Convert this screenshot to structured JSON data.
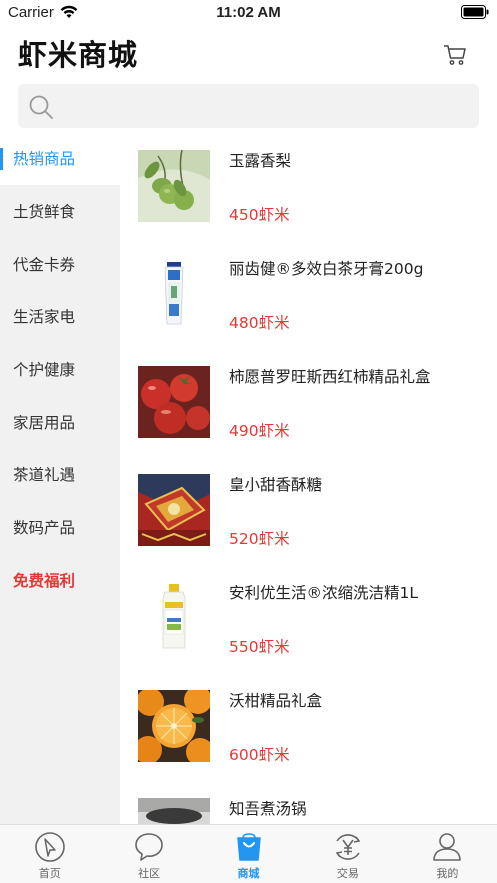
{
  "status_bar": {
    "carrier": "Carrier",
    "time": "11:02 AM"
  },
  "header": {
    "title": "虾米商城",
    "cart_icon": "cart-icon"
  },
  "search": {
    "placeholder": "",
    "value": "",
    "icon": "search-icon"
  },
  "sidebar": {
    "items": [
      {
        "label": "热销商品",
        "state": "active"
      },
      {
        "label": "土货鲜食",
        "state": "normal"
      },
      {
        "label": "代金卡券",
        "state": "normal"
      },
      {
        "label": "生活家电",
        "state": "normal"
      },
      {
        "label": "个护健康",
        "state": "normal"
      },
      {
        "label": "家居用品",
        "state": "normal"
      },
      {
        "label": "茶道礼遇",
        "state": "normal"
      },
      {
        "label": "数码产品",
        "state": "normal"
      },
      {
        "label": "免费福利",
        "state": "highlight"
      }
    ]
  },
  "products": [
    {
      "name": "玉露香梨",
      "price": "450虾米"
    },
    {
      "name": "丽齿健®多效白茶牙膏200g",
      "price": "480虾米"
    },
    {
      "name": "柿愿普罗旺斯西红柿精品礼盒",
      "price": "490虾米"
    },
    {
      "name": "皇小甜香酥糖",
      "price": "520虾米"
    },
    {
      "name": "安利优生活®浓缩洗洁精1L",
      "price": "550虾米"
    },
    {
      "name": "沃柑精品礼盒",
      "price": "600虾米"
    },
    {
      "name": "知吾煮汤锅",
      "price": ""
    }
  ],
  "tab_bar": {
    "items": [
      {
        "label": "首页",
        "icon": "compass-icon"
      },
      {
        "label": "社区",
        "icon": "chat-bubble-icon"
      },
      {
        "label": "商城",
        "icon": "shopping-bag-icon"
      },
      {
        "label": "交易",
        "icon": "yen-exchange-icon"
      },
      {
        "label": "我的",
        "icon": "person-icon"
      }
    ],
    "active_index": 2
  },
  "colors": {
    "accent": "#2196f3",
    "price": "#e53935",
    "sidebar_bg": "#f1f1f1"
  }
}
